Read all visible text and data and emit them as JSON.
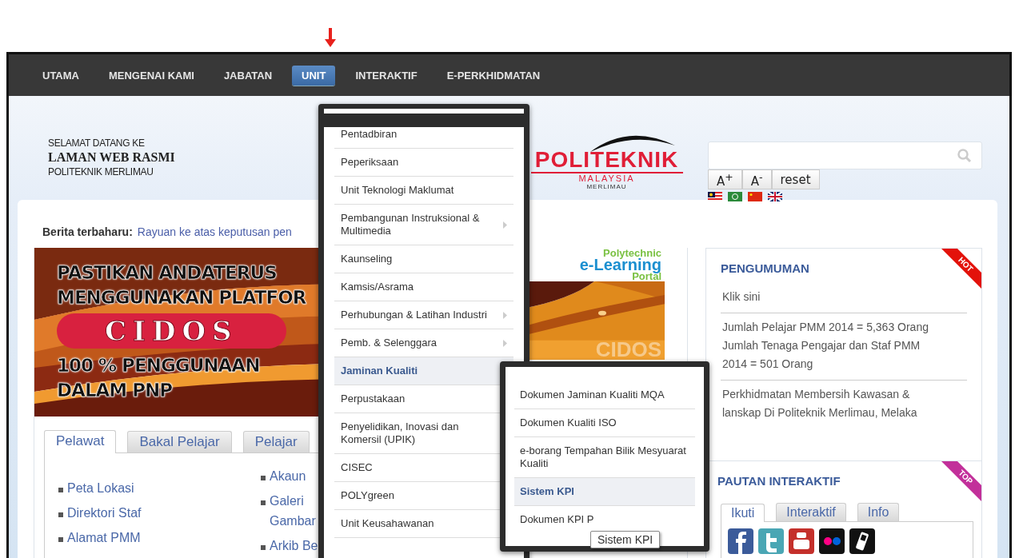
{
  "nav": [
    {
      "label": "UTAMA",
      "selected": false
    },
    {
      "label": "MENGENAI KAMI",
      "selected": false
    },
    {
      "label": "JABATAN",
      "selected": false
    },
    {
      "label": "UNIT",
      "selected": true
    },
    {
      "label": "INTERAKTIF",
      "selected": false
    },
    {
      "label": "E-PERKHIDMATAN",
      "selected": false
    }
  ],
  "header": {
    "welcome": [
      "SELAMAT DATANG KE",
      "LAMAN WEB RASMI",
      "POLITEKNIK MERLIMAU"
    ],
    "logo": {
      "title": "POLITEKNIK",
      "subtitle": "MALAYSIA",
      "campus": "MERLIMAU"
    },
    "font_buttons": [
      "A$^{+}$",
      "A$^{-}$",
      "reset"
    ]
  },
  "news": {
    "label": "Berita terbaharu:",
    "text": "Rayuan ke atas keputusan pen"
  },
  "banner": {
    "lines": [
      "PASTIKAN ANDATERUS",
      "MENGGUNAKAN PLATFOR"
    ],
    "brand": "CIDOS",
    "lines_after": [
      "100 % PENGGUNAAN",
      "DALAM PNP"
    ]
  },
  "elearning": {
    "lines": [
      "Polytechnic",
      "e-Learning",
      "Portal"
    ],
    "brand": "CIDOS"
  },
  "visitor_tabs": [
    {
      "label": "Pelawat",
      "selected": true
    },
    {
      "label": "Bakal Pelajar",
      "selected": false
    },
    {
      "label": "Pelajar",
      "selected": false
    }
  ],
  "links_col1": [
    "Peta Lokasi",
    "Direktori Staf",
    "Alamat PMM"
  ],
  "links_col2": [
    "Akaun",
    "Galeri Gambar",
    "Arkib Be"
  ],
  "announcements": {
    "title": "PENGUMUMAN",
    "ribbon": "HOT",
    "items": [
      [
        "Klik sini"
      ],
      [
        "Jumlah Pelajar PMM 2014 = 5,363 Orang",
        "Jumlah Tenaga Pengajar dan Staf PMM 2014 = 501 Orang"
      ],
      [
        "Perkhidmatan Membersih Kawasan & lanskap Di Politeknik Merlimau, Melaka"
      ]
    ]
  },
  "interactive": {
    "title": "PAUTAN INTERAKTIF",
    "ribbon": "TOP",
    "tabs": [
      {
        "label": "Ikuti",
        "selected": true
      },
      {
        "label": "Interaktif",
        "selected": false
      },
      {
        "label": "Info",
        "selected": false
      }
    ]
  },
  "menu": {
    "items": [
      {
        "label": "Pentadbiran",
        "has_submenu": false,
        "selected": false
      },
      {
        "label": "Peperiksaan",
        "has_submenu": false,
        "selected": false
      },
      {
        "label": "Unit Teknologi Maklumat",
        "has_submenu": false,
        "selected": false
      },
      {
        "label": "Pembangunan Instruksional & Multimedia",
        "has_submenu": true,
        "selected": false
      },
      {
        "label": "Kaunseling",
        "has_submenu": false,
        "selected": false
      },
      {
        "label": "Kamsis/Asrama",
        "has_submenu": false,
        "selected": false
      },
      {
        "label": "Perhubungan & Latihan Industri",
        "has_submenu": true,
        "selected": false
      },
      {
        "label": "Pemb. & Selenggara",
        "has_submenu": true,
        "selected": false
      },
      {
        "label": "Jaminan Kualiti",
        "has_submenu": false,
        "selected": true
      },
      {
        "label": "Perpustakaan",
        "has_submenu": false,
        "selected": false
      },
      {
        "label": "Penyelidikan, Inovasi dan Komersil (UPIK)",
        "has_submenu": false,
        "selected": false
      },
      {
        "label": "CISEC",
        "has_submenu": false,
        "selected": false
      },
      {
        "label": "POLYgreen",
        "has_submenu": false,
        "selected": false
      },
      {
        "label": "Unit Keusahawanan",
        "has_submenu": false,
        "selected": false
      }
    ]
  },
  "submenu": {
    "items": [
      {
        "label": "Dokumen Jaminan Kualiti MQA",
        "selected": false
      },
      {
        "label": "Dokumen Kualiti ISO",
        "selected": false
      },
      {
        "label": "e-borang Tempahan Bilik Mesyuarat Kualiti",
        "selected": false
      },
      {
        "label": "Sistem KPI",
        "selected": true
      },
      {
        "label": "Dokumen KPI P",
        "selected": false
      }
    ]
  },
  "tooltip": "Sistem KPI"
}
